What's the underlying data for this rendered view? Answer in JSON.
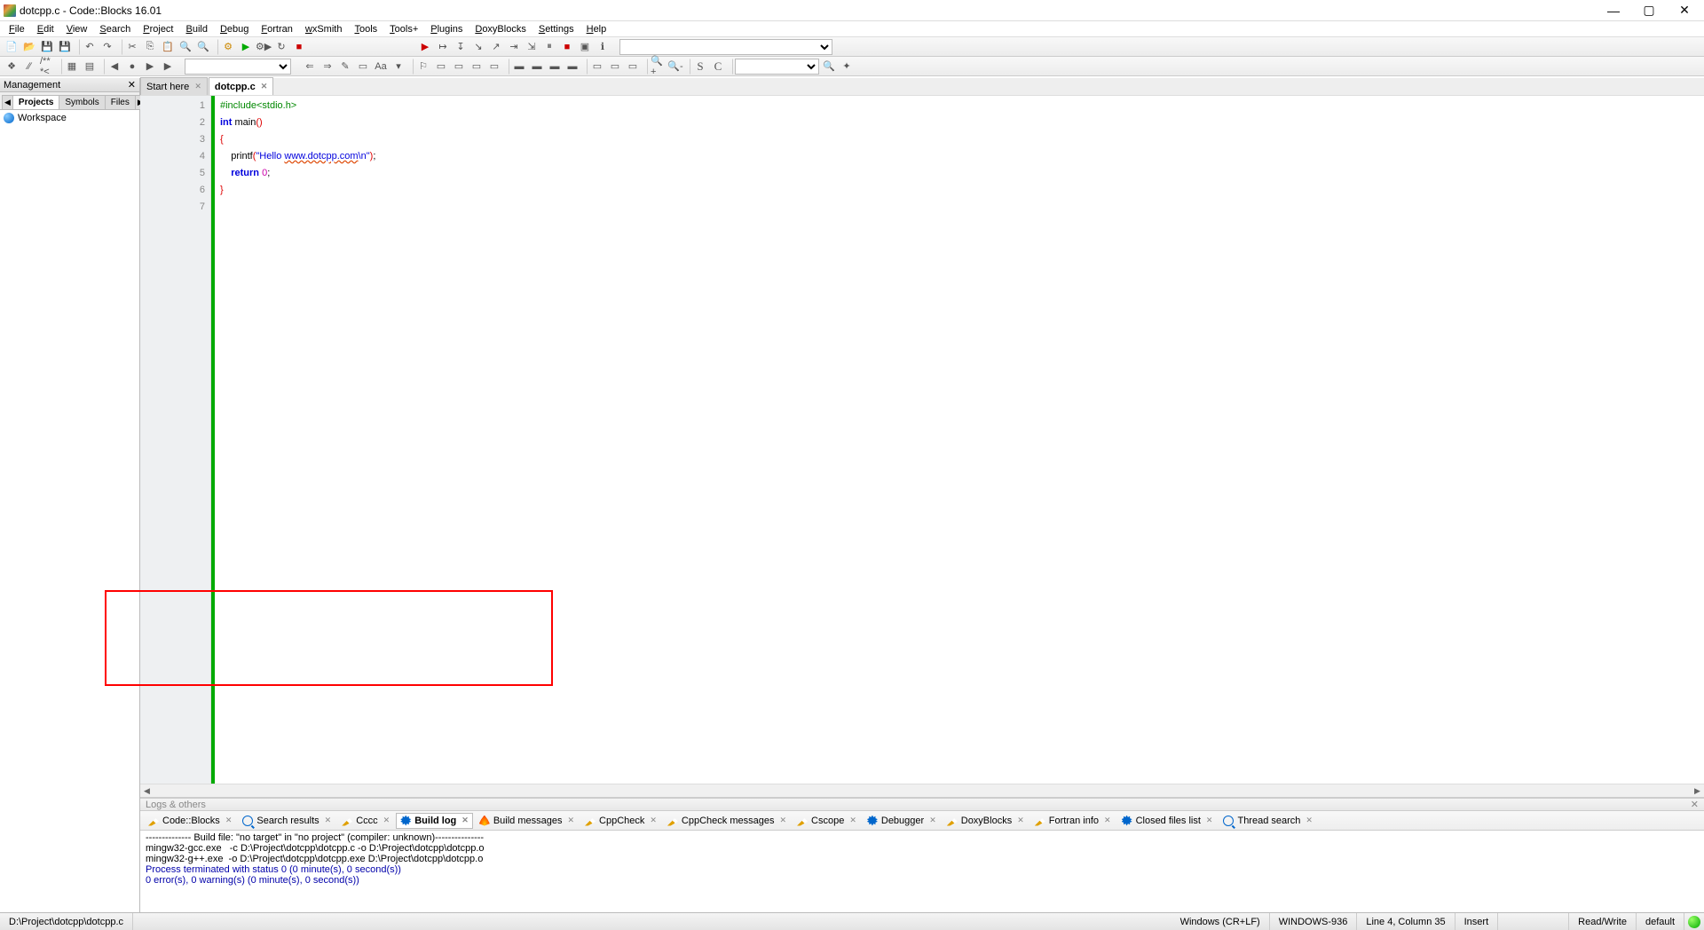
{
  "titlebar": {
    "title": "dotcpp.c - Code::Blocks 16.01"
  },
  "menu": [
    "File",
    "Edit",
    "View",
    "Search",
    "Project",
    "Build",
    "Debug",
    "Fortran",
    "wxSmith",
    "Tools",
    "Tools+",
    "Plugins",
    "DoxyBlocks",
    "Settings",
    "Help"
  ],
  "management": {
    "title": "Management",
    "tabs_nav_left": "◀",
    "tabs": [
      "Projects",
      "Symbols",
      "Files"
    ],
    "tabs_nav_right": "▶",
    "active_tab": 0,
    "tree": [
      {
        "label": "Workspace"
      }
    ]
  },
  "editor": {
    "tabs": [
      {
        "label": "Start here",
        "active": false
      },
      {
        "label": "dotcpp.c",
        "active": true
      }
    ],
    "lines": [
      [
        {
          "c": "kw-pre",
          "t": "#include<stdio.h>"
        }
      ],
      [
        {
          "c": "kw-blue",
          "t": "int "
        },
        {
          "c": "plain",
          "t": "main"
        },
        {
          "c": "brace",
          "t": "()"
        }
      ],
      [
        {
          "c": "brace",
          "t": "{"
        }
      ],
      [
        {
          "c": "plain",
          "t": "    printf"
        },
        {
          "c": "brace",
          "t": "("
        },
        {
          "c": "str",
          "t": "\"Hello "
        },
        {
          "c": "url",
          "t": "www.dotcpp.com"
        },
        {
          "c": "str",
          "t": "\\n\""
        },
        {
          "c": "brace",
          "t": ")"
        },
        {
          "c": "plain",
          "t": ";"
        }
      ],
      [
        {
          "c": "plain",
          "t": "    "
        },
        {
          "c": "kw-blue",
          "t": "return "
        },
        {
          "c": "num",
          "t": "0"
        },
        {
          "c": "plain",
          "t": ";"
        }
      ],
      [
        {
          "c": "brace",
          "t": "}"
        }
      ],
      [
        {
          "c": "plain",
          "t": ""
        }
      ]
    ]
  },
  "logs": {
    "title": "Logs & others",
    "tabs": [
      {
        "icon": "pencil",
        "label": "Code::Blocks"
      },
      {
        "icon": "mag",
        "label": "Search results"
      },
      {
        "icon": "pencil",
        "label": "Cccc"
      },
      {
        "icon": "gear",
        "label": "Build log"
      },
      {
        "icon": "flame",
        "label": "Build messages"
      },
      {
        "icon": "pencil",
        "label": "CppCheck"
      },
      {
        "icon": "pencil",
        "label": "CppCheck messages"
      },
      {
        "icon": "pencil",
        "label": "Cscope"
      },
      {
        "icon": "gear",
        "label": "Debugger"
      },
      {
        "icon": "pencil",
        "label": "DoxyBlocks"
      },
      {
        "icon": "pencil",
        "label": "Fortran info"
      },
      {
        "icon": "gear",
        "label": "Closed files list"
      },
      {
        "icon": "mag",
        "label": "Thread search"
      }
    ],
    "active_tab": 3,
    "body_lines": [
      {
        "c": "",
        "t": "-------------- Build file: \"no target\" in \"no project\" (compiler: unknown)---------------"
      },
      {
        "c": "",
        "t": "mingw32-gcc.exe   -c D:\\Project\\dotcpp\\dotcpp.c -o D:\\Project\\dotcpp\\dotcpp.o"
      },
      {
        "c": "",
        "t": "mingw32-g++.exe  -o D:\\Project\\dotcpp\\dotcpp.exe D:\\Project\\dotcpp\\dotcpp.o"
      },
      {
        "c": "blue",
        "t": "Process terminated with status 0 (0 minute(s), 0 second(s))"
      },
      {
        "c": "blue",
        "t": "0 error(s), 0 warning(s) (0 minute(s), 0 second(s))"
      }
    ]
  },
  "status": {
    "path": "D:\\Project\\dotcpp\\dotcpp.c",
    "eol": "Windows (CR+LF)",
    "enc": "WINDOWS-936",
    "pos": "Line 4, Column 35",
    "ins": "Insert",
    "rw": "Read/Write",
    "hl": "default"
  }
}
